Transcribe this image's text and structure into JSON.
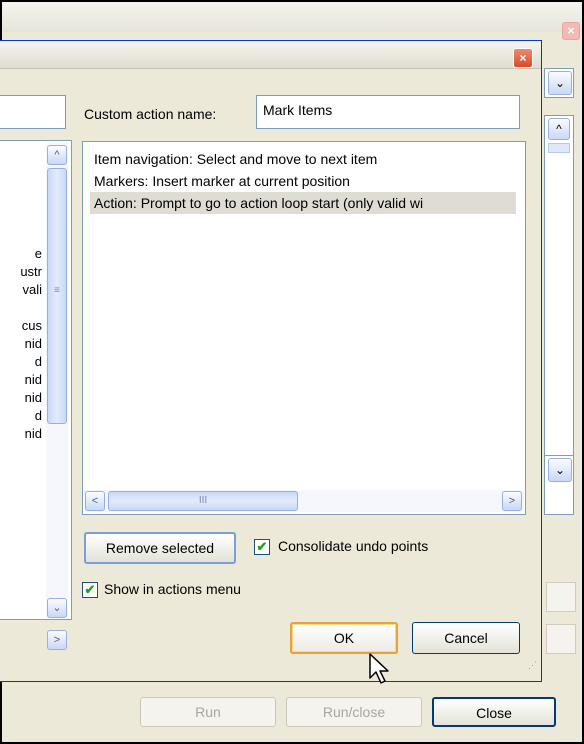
{
  "outer_window": {
    "close_glyph": "×",
    "combo_arrow": "⌄",
    "list_up": "^",
    "combo2_arrow": "⌄",
    "buttons": {
      "run": "Run",
      "run_close": "Run/close",
      "close": "Close"
    }
  },
  "dialog": {
    "close_glyph": "×",
    "custom_action_label": "Custom action name:",
    "custom_action_value": "Mark Items",
    "left_list": {
      "visible_fragments": [
        "e",
        "ustr",
        "vali",
        "",
        "cus",
        "nid",
        "d",
        "nid",
        "nid",
        "d",
        "nid"
      ],
      "up": "^",
      "down": "⌄",
      "thumb_grip": "≡",
      "hscroll_right": ">"
    },
    "actions": [
      {
        "text": "Item navigation: Select and move to next item",
        "selected": false
      },
      {
        "text": "Markers: Insert marker at current position",
        "selected": false
      },
      {
        "text": "Action: Prompt to go to action loop start (only valid wi",
        "selected": true
      }
    ],
    "hscroll": {
      "left": "<",
      "right": ">",
      "thumb_grip": "III"
    },
    "remove_selected_label": "Remove selected",
    "consolidate_undo": {
      "label": "Consolidate undo points",
      "checked": true,
      "mark": "✔"
    },
    "show_in_menu": {
      "label": "Show in actions menu",
      "checked": true,
      "mark": "✔"
    },
    "ok_label": "OK",
    "cancel_label": "Cancel",
    "grip": "⋰"
  }
}
